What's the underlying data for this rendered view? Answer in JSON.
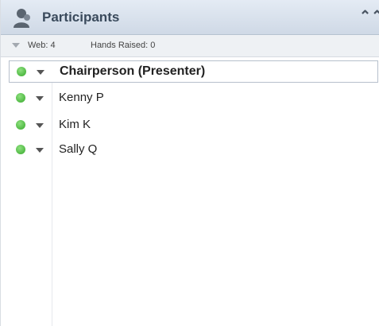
{
  "panel": {
    "title": "Participants",
    "title_icon": "person-icon",
    "collapse_icon": "double-chevron-up-icon"
  },
  "stats": {
    "web": "Web: 4",
    "hands_raised": "Hands Raised: 0"
  },
  "participants": [
    {
      "name": "Chairperson (Presenter)",
      "status": "online",
      "selected": true
    },
    {
      "name": "Kenny P",
      "status": "online",
      "selected": false
    },
    {
      "name": "Kim K",
      "status": "online",
      "selected": false
    },
    {
      "name": "Sally Q",
      "status": "online",
      "selected": false
    }
  ],
  "colors": {
    "status_online": "#3fb034",
    "header_bg": "#d8e1ec",
    "title_text": "#3a4a5c"
  }
}
